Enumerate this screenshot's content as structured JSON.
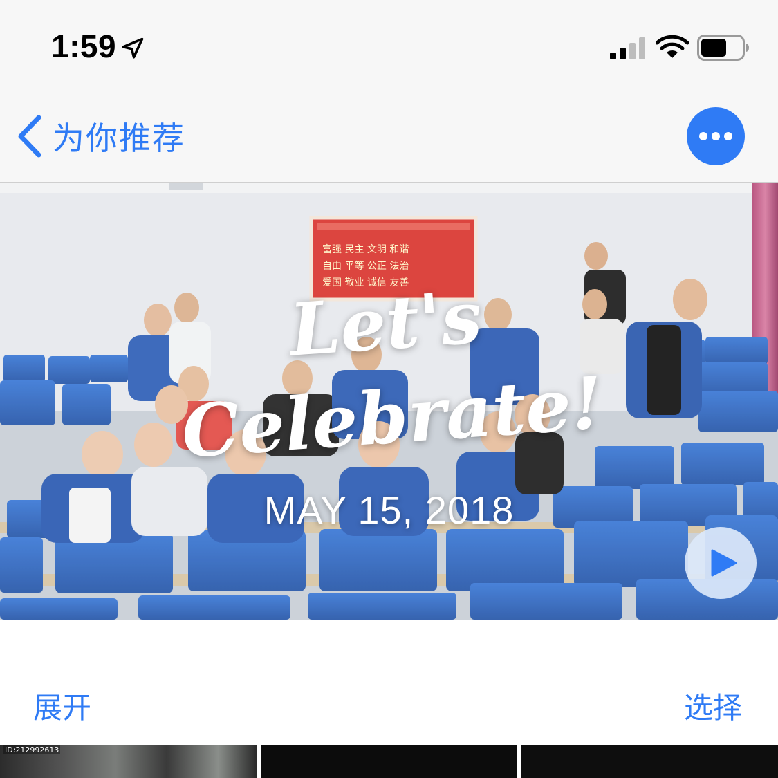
{
  "status_bar": {
    "time": "1:59",
    "icons": [
      "location-arrow-icon",
      "cellular-signal-icon",
      "wifi-icon",
      "battery-icon"
    ]
  },
  "nav": {
    "back_label": "为你推荐",
    "back_icon": "chevron-left-icon",
    "more_icon": "ellipsis-icon"
  },
  "hero": {
    "title": "Let's\nCelebrate!",
    "date": "MAY 15, 2018",
    "play_icon": "play-icon",
    "banner_lines": [
      "富强 民主 文明 和谐",
      "自由 平等 公正 法治",
      "爱国 敬业 诚信 友善"
    ]
  },
  "actions": {
    "expand_label": "展开",
    "select_label": "选择"
  },
  "thumbnails": {
    "first_overlay_label": "ID:212992613"
  },
  "colors": {
    "accent": "#2f7bf5",
    "bar_background": "#f7f7f7",
    "seat_blue": "#2d67c7"
  }
}
